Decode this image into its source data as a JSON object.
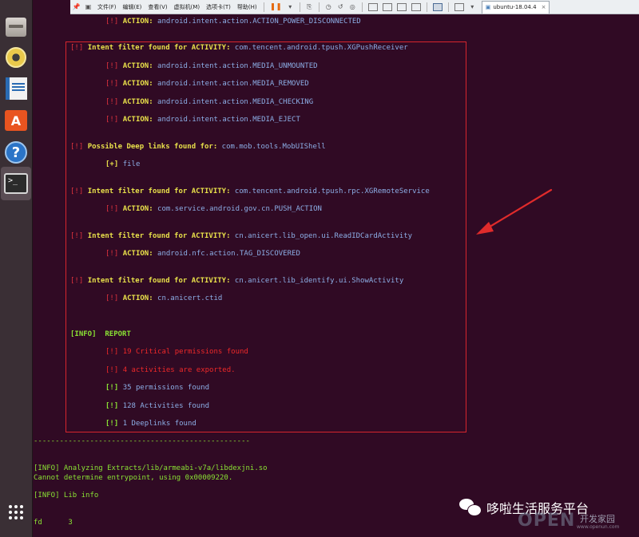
{
  "vm_toolbar": {
    "menus": [
      "文件(F)",
      "编辑(E)",
      "查看(V)",
      "虚拟机(M)",
      "选项卡(T)",
      "帮助(H)"
    ],
    "tab_label": "ubuntu-18.04.4",
    "tab_close": "×"
  },
  "launcher": {
    "help_glyph": "?",
    "store_glyph": "A",
    "terminal_glyph": ">_"
  },
  "terminal": {
    "line_top": {
      "tag": "[!]",
      "label": "ACTION:",
      "value": "android.intent.action.ACTION_POWER_DISCONNECTED"
    },
    "filter1": {
      "tag": "[!]",
      "label": "Intent filter found for ACTIVITY:",
      "value": "com.tencent.android.tpush.XGPushReceiver"
    },
    "filter1_actions": [
      {
        "tag": "[!]",
        "label": "ACTION:",
        "value": "android.intent.action.MEDIA_UNMOUNTED"
      },
      {
        "tag": "[!]",
        "label": "ACTION:",
        "value": "android.intent.action.MEDIA_REMOVED"
      },
      {
        "tag": "[!]",
        "label": "ACTION:",
        "value": "android.intent.action.MEDIA_CHECKING"
      },
      {
        "tag": "[!]",
        "label": "ACTION:",
        "value": "android.intent.action.MEDIA_EJECT"
      }
    ],
    "deeplink": {
      "tag": "[!]",
      "label": "Possible Deep links found for:",
      "value": "com.mob.tools.MobUIShell"
    },
    "deeplink_item": {
      "tag": "[+]",
      "value": "file"
    },
    "filter2": {
      "tag": "[!]",
      "label": "Intent filter found for ACTIVITY:",
      "value": "com.tencent.android.tpush.rpc.XGRemoteService"
    },
    "filter2_action": {
      "tag": "[!]",
      "label": "ACTION:",
      "value": "com.service.android.gov.cn.PUSH_ACTION"
    },
    "filter3": {
      "tag": "[!]",
      "label": "Intent filter found for ACTIVITY:",
      "value": "cn.anicert.lib_open.ui.ReadIDCardActivity"
    },
    "filter3_action": {
      "tag": "[!]",
      "label": "ACTION:",
      "value": "android.nfc.action.TAG_DISCOVERED"
    },
    "filter4": {
      "tag": "[!]",
      "label": "Intent filter found for ACTIVITY:",
      "value": "cn.anicert.lib_identify.ui.ShowActivity"
    },
    "filter4_action": {
      "tag": "[!]",
      "label": "ACTION:",
      "value": "cn.anicert.ctid"
    },
    "report": {
      "tag": "[INFO]",
      "label": "REPORT"
    },
    "report_items": [
      {
        "tag": "[!]",
        "text": "19 Critical permissions found",
        "color": "#ef2929"
      },
      {
        "tag": "[!]",
        "text": "4 activities are exported.",
        "color": "#ef2929"
      },
      {
        "tag": "[!]",
        "text": "35 permissions found",
        "color": "#8caee6"
      },
      {
        "tag": "[!]",
        "text": "128 Activities found",
        "color": "#8caee6"
      },
      {
        "tag": "[!]",
        "text": "1 Deeplinks found",
        "color": "#8caee6"
      }
    ],
    "separator": "--------------------------------------------------",
    "analyzing": "[INFO] Analyzing Extracts/lib/armeabi-v7a/libdexjni.so",
    "entrypoint": "Cannot determine entrypoint, using 0x00009220.",
    "lib_info": "[INFO] Lib info",
    "fd_label": "fd",
    "fd_value": "3"
  },
  "watermark": {
    "text": "哆啦生活服务平台",
    "logo": "OPEN",
    "logo_cn": "开发家园",
    "logo_url": "www.openun.com"
  },
  "colors": {
    "background": "#300a24",
    "highlight_box": "#d6252d",
    "arrow": "#e02b2b"
  }
}
